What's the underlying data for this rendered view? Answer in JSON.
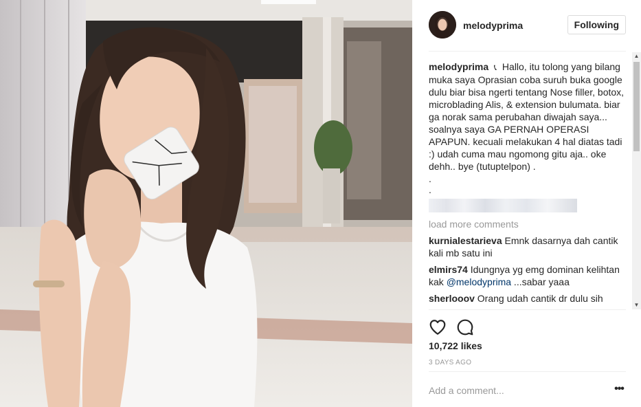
{
  "post": {
    "username": "melodyprima",
    "follow_label": "Following",
    "caption": {
      "username": "melodyprima",
      "phone_icon": "telephone-icon",
      "text": "Hallo, itu tolong yang bilang muka saya Oprasian coba suruh buka google dulu biar bisa ngerti tentang Nose filler, botox, microblading Alis, & extension bulumata. biar ga norak sama perubahan diwajah saya... soalnya saya GA PERNAH OPERASI APAPUN. kecuali melakukan 4 hal diatas tadi :) udah cuma mau ngomong gitu aja.. oke dehh.. bye (tutuptelpon) .",
      "dot1": ".",
      "dot2": "."
    },
    "load_more": "load more comments",
    "comments": [
      {
        "username": "kurnialestarieva",
        "text": "Emnk dasarnya dah cantik kali mb satu ini"
      },
      {
        "username": "elmirs74",
        "text_before": "Idungnya yg emg dominan kelihtan kak ",
        "mention": "@melodyprima",
        "text_after": " ...sabar yaaa"
      },
      {
        "username": "sherlooov",
        "text": "Orang udah cantik dr dulu sih"
      }
    ],
    "likes": "10,722 likes",
    "time": "3 DAYS AGO",
    "comment_placeholder": "Add a comment...",
    "more_label": "•••"
  },
  "icons": {
    "like": "heart-icon",
    "comment": "comment-bubble-icon",
    "scroll_up": "arrow-up-icon",
    "scroll_down": "arrow-down-icon"
  },
  "colors": {
    "mention": "#003569",
    "muted": "#999999",
    "text": "#262626",
    "border": "#dbdbdb"
  }
}
